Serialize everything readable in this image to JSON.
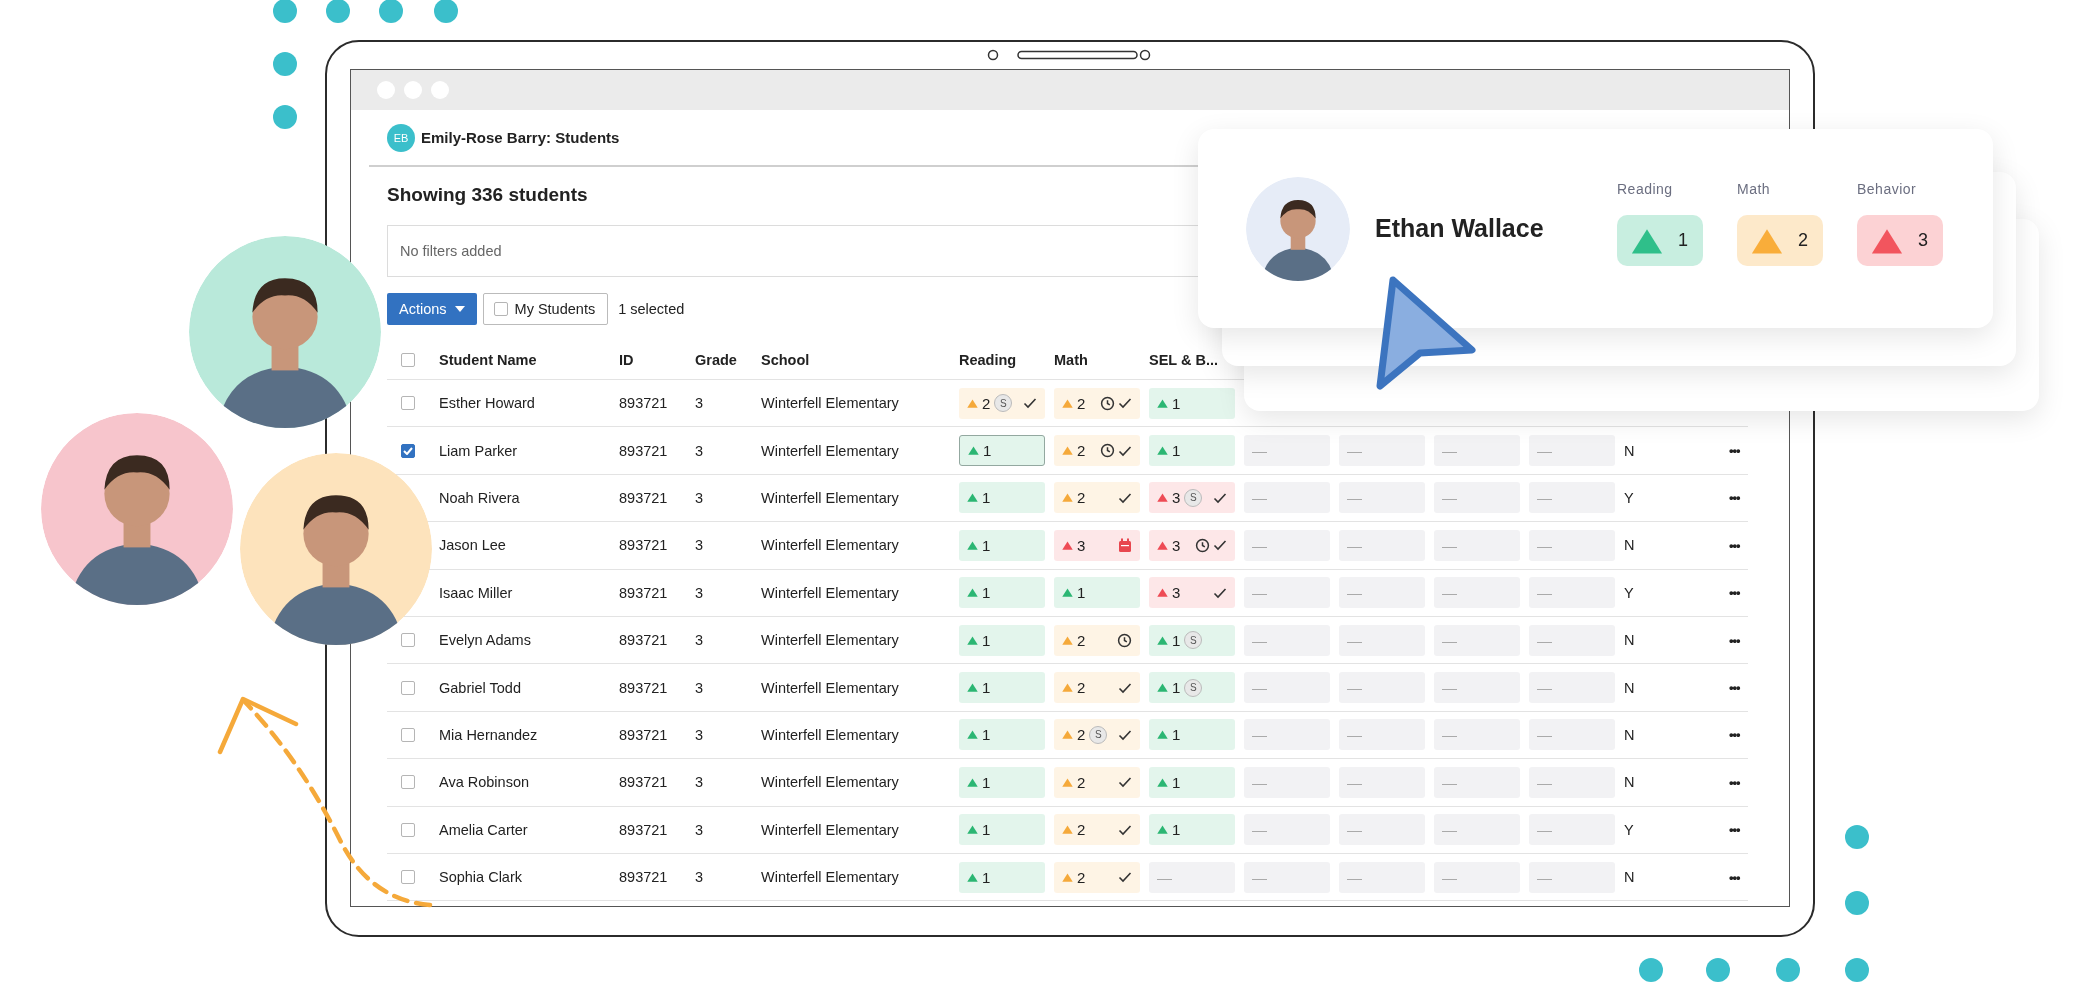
{
  "header": {
    "initials": "EB",
    "title": "Emily-Rose Barry: Students"
  },
  "summary": "Showing 336 students",
  "filter": {
    "placeholder": "No filters added"
  },
  "toolbar": {
    "actions": "Actions",
    "my_students": {
      "label": "My Students",
      "checked": false
    },
    "selection": "1 selected"
  },
  "table": {
    "header_checked": false,
    "columns": [
      "Student Name",
      "ID",
      "Grade",
      "School",
      "Reading",
      "Math",
      "SEL & B..."
    ],
    "rows": [
      {
        "checked": false,
        "name": "Esther Howard",
        "id": "893721",
        "grade": "3",
        "school": "Winterfell Elementary",
        "scores": [
          {
            "kind": "score",
            "color": "#f5a93a",
            "value": "2",
            "badge": "S",
            "icons": [
              {
                "kind": "check"
              }
            ],
            "focused": false
          },
          {
            "kind": "score",
            "color": "#f5a93a",
            "value": "2",
            "icons": [
              {
                "kind": "clock"
              },
              {
                "kind": "check"
              }
            ],
            "focused": false
          },
          {
            "kind": "score",
            "color": "#2bb673",
            "value": "1",
            "focused": false
          }
        ]
      },
      {
        "checked": true,
        "name": "Liam Parker",
        "id": "893721",
        "grade": "3",
        "school": "Winterfell Elementary",
        "scores": [
          {
            "kind": "score",
            "color": "#2bb673",
            "value": "1",
            "focused": true
          },
          {
            "kind": "score",
            "color": "#f5a93a",
            "value": "2",
            "icons": [
              {
                "kind": "clock"
              },
              {
                "kind": "check"
              }
            ],
            "focused": false
          },
          {
            "kind": "score",
            "color": "#2bb673",
            "value": "1",
            "focused": false
          }
        ],
        "others": [
          "—",
          "—",
          "—",
          "—"
        ],
        "flag": "N",
        "more": "•••"
      },
      {
        "name": "Noah Rivera",
        "id": "893721",
        "grade": "3",
        "school": "Winterfell Elementary",
        "scores": [
          {
            "kind": "score",
            "color": "#2bb673",
            "value": "1",
            "focused": false
          },
          {
            "kind": "score",
            "color": "#f5a93a",
            "value": "2",
            "icons": [
              {
                "kind": "check"
              }
            ],
            "focused": false
          },
          {
            "kind": "score",
            "color": "#ee4b55",
            "value": "3",
            "badge": "S",
            "icons": [
              {
                "kind": "check"
              }
            ],
            "focused": false
          }
        ],
        "others": [
          "—",
          "—",
          "—",
          "—"
        ],
        "flag": "Y",
        "more": "•••"
      },
      {
        "name": "Jason Lee",
        "id": "893721",
        "grade": "3",
        "school": "Winterfell Elementary",
        "scores": [
          {
            "kind": "score",
            "color": "#2bb673",
            "value": "1",
            "focused": false
          },
          {
            "kind": "score",
            "color": "#ee4b55",
            "value": "3",
            "icons": [
              {
                "kind": "calendar"
              }
            ],
            "focused": false
          },
          {
            "kind": "score",
            "color": "#ee4b55",
            "value": "3",
            "icons": [
              {
                "kind": "clock"
              },
              {
                "kind": "check"
              }
            ],
            "focused": false
          }
        ],
        "others": [
          "—",
          "—",
          "—",
          "—"
        ],
        "flag": "N",
        "more": "•••"
      },
      {
        "name": "Isaac Miller",
        "id": "893721",
        "grade": "3",
        "school": "Winterfell Elementary",
        "scores": [
          {
            "kind": "score",
            "color": "#2bb673",
            "value": "1",
            "focused": false
          },
          {
            "kind": "score",
            "color": "#2bb673",
            "value": "1",
            "focused": false
          },
          {
            "kind": "score",
            "color": "#ee4b55",
            "value": "3",
            "icons": [
              {
                "kind": "check"
              }
            ],
            "focused": false
          }
        ],
        "others": [
          "—",
          "—",
          "—",
          "—"
        ],
        "flag": "Y",
        "more": "•••"
      },
      {
        "checked": false,
        "name": "Evelyn Adams",
        "id": "893721",
        "grade": "3",
        "school": "Winterfell Elementary",
        "scores": [
          {
            "kind": "score",
            "color": "#2bb673",
            "value": "1",
            "focused": false
          },
          {
            "kind": "score",
            "color": "#f5a93a",
            "value": "2",
            "icons": [
              {
                "kind": "clock"
              }
            ],
            "focused": false
          },
          {
            "kind": "score",
            "color": "#2bb673",
            "value": "1",
            "badge": "S",
            "focused": false
          }
        ],
        "others": [
          "—",
          "—",
          "—",
          "—"
        ],
        "flag": "N",
        "more": "•••"
      },
      {
        "checked": false,
        "name": "Gabriel Todd",
        "id": "893721",
        "grade": "3",
        "school": "Winterfell Elementary",
        "scores": [
          {
            "kind": "score",
            "color": "#2bb673",
            "value": "1",
            "focused": false
          },
          {
            "kind": "score",
            "color": "#f5a93a",
            "value": "2",
            "icons": [
              {
                "kind": "check"
              }
            ],
            "focused": false
          },
          {
            "kind": "score",
            "color": "#2bb673",
            "value": "1",
            "badge": "S",
            "focused": false
          }
        ],
        "others": [
          "—",
          "—",
          "—",
          "—"
        ],
        "flag": "N",
        "more": "•••"
      },
      {
        "checked": false,
        "name": "Mia Hernandez",
        "id": "893721",
        "grade": "3",
        "school": "Winterfell Elementary",
        "scores": [
          {
            "kind": "score",
            "color": "#2bb673",
            "value": "1",
            "focused": false
          },
          {
            "kind": "score",
            "color": "#f5a93a",
            "value": "2",
            "badge": "S",
            "icons": [
              {
                "kind": "check"
              }
            ],
            "focused": false
          },
          {
            "kind": "score",
            "color": "#2bb673",
            "value": "1",
            "focused": false
          }
        ],
        "others": [
          "—",
          "—",
          "—",
          "—"
        ],
        "flag": "N",
        "more": "•••"
      },
      {
        "checked": false,
        "name": "Ava Robinson",
        "id": "893721",
        "grade": "3",
        "school": "Winterfell Elementary",
        "scores": [
          {
            "kind": "score",
            "color": "#2bb673",
            "value": "1",
            "focused": false
          },
          {
            "kind": "score",
            "color": "#f5a93a",
            "value": "2",
            "icons": [
              {
                "kind": "check"
              }
            ],
            "focused": false
          },
          {
            "kind": "score",
            "color": "#2bb673",
            "value": "1",
            "focused": false
          }
        ],
        "others": [
          "—",
          "—",
          "—",
          "—"
        ],
        "flag": "N",
        "more": "•••"
      },
      {
        "checked": false,
        "name": "Amelia Carter",
        "id": "893721",
        "grade": "3",
        "school": "Winterfell Elementary",
        "scores": [
          {
            "kind": "score",
            "color": "#2bb673",
            "value": "1",
            "focused": false
          },
          {
            "kind": "score",
            "color": "#f5a93a",
            "value": "2",
            "icons": [
              {
                "kind": "check"
              }
            ],
            "focused": false
          },
          {
            "kind": "score",
            "color": "#2bb673",
            "value": "1",
            "focused": false
          }
        ],
        "others": [
          "—",
          "—",
          "—",
          "—"
        ],
        "flag": "Y",
        "more": "•••"
      },
      {
        "checked": false,
        "name": "Sophia Clark",
        "id": "893721",
        "grade": "3",
        "school": "Winterfell Elementary",
        "scores": [
          {
            "kind": "score",
            "color": "#2bb673",
            "value": "1",
            "focused": false
          },
          {
            "kind": "score",
            "color": "#f5a93a",
            "value": "2",
            "icons": [
              {
                "kind": "check"
              }
            ],
            "focused": false
          },
          {
            "kind": "empty",
            "value": "—"
          }
        ],
        "others": [
          "—",
          "—",
          "—",
          "—"
        ],
        "flag": "N",
        "more": "•••"
      }
    ]
  },
  "student_card": {
    "name": "Ethan Wallace",
    "scores": [
      {
        "label": "Reading",
        "value": "1",
        "color": "#2fbf8a"
      },
      {
        "label": "Math",
        "value": "2",
        "color": "#f9ad3a"
      },
      {
        "label": "Behavior",
        "value": "3",
        "color": "#f2555e"
      }
    ]
  }
}
